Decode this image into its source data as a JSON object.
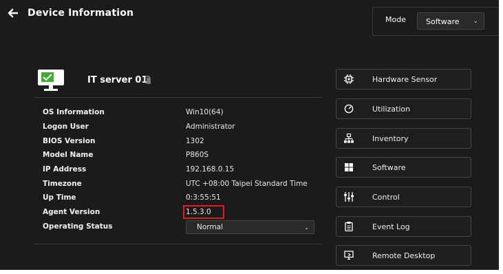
{
  "header": {
    "title": "Device Information",
    "mode_label": "Mode",
    "mode_value": "Software"
  },
  "device": {
    "name": "IT server 01",
    "info": [
      {
        "label": "OS Information",
        "value": "Win10(64)"
      },
      {
        "label": "Logon User",
        "value": "Administrator"
      },
      {
        "label": "BIOS Version",
        "value": "1302"
      },
      {
        "label": "Model Name",
        "value": "P860S"
      },
      {
        "label": "IP Address",
        "value": "192.168.0.15"
      },
      {
        "label": "Timezone",
        "value": "UTC +08:00 Taipei Standard Time"
      },
      {
        "label": "Up Time",
        "value": "0:3:55:51"
      },
      {
        "label": "Agent Version",
        "value": "1.5.3.0"
      },
      {
        "label": "Operating Status",
        "value": "Normal"
      }
    ]
  },
  "menu": [
    {
      "label": "Hardware Sensor",
      "icon": "chip-icon"
    },
    {
      "label": "Utilization",
      "icon": "gauge-icon"
    },
    {
      "label": "Inventory",
      "icon": "hierarchy-icon"
    },
    {
      "label": "Software",
      "icon": "grid-icon"
    },
    {
      "label": "Control",
      "icon": "sliders-icon"
    },
    {
      "label": "Event Log",
      "icon": "clipboard-icon"
    },
    {
      "label": "Remote Desktop",
      "icon": "monitor-icon"
    }
  ],
  "colors": {
    "background": "#1b1b1b",
    "status_ok": "#3fae2a",
    "highlight_box": "#e11b22"
  }
}
